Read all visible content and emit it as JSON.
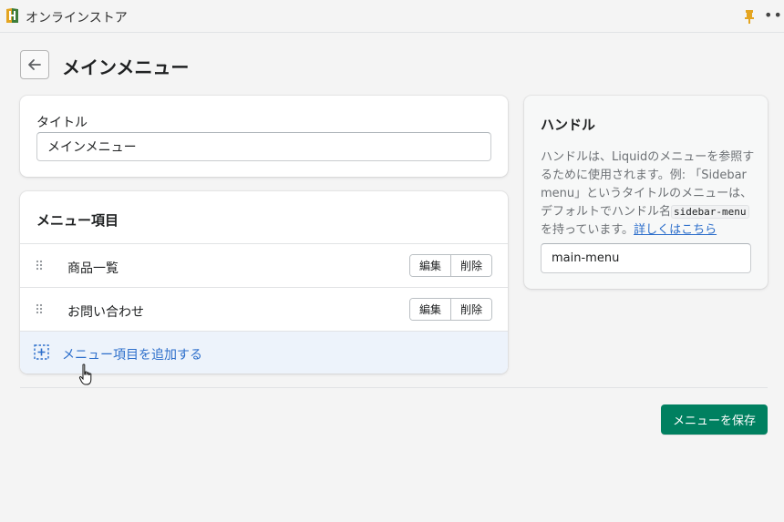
{
  "topbar": {
    "app_icon": "store-logo-icon",
    "app_title": "オンラインストア",
    "pin_icon": "pin-icon",
    "more_icon": "more-horizontal-icon",
    "more_glyph": "•••"
  },
  "header": {
    "back_icon": "arrow-left-icon",
    "title": "メインメニュー"
  },
  "title_card": {
    "label": "タイトル",
    "input_value": "メインメニュー"
  },
  "menu_card": {
    "heading": "メニュー項目",
    "items": [
      {
        "label": "商品一覧",
        "edit_label": "編集",
        "delete_label": "削除"
      },
      {
        "label": "お問い合わせ",
        "edit_label": "編集",
        "delete_label": "削除"
      }
    ],
    "add_label": "メニュー項目を追加する"
  },
  "handle_card": {
    "title": "ハンドル",
    "description_part1": "ハンドルは、Liquidのメニューを参照するために使用されます。例: 「Sidebar menu」というタイトルのメニューは、デフォルトでハンドル名",
    "description_code": "sidebar-menu",
    "description_part2": "を持っています。",
    "learn_more_link": "詳しくはこちら",
    "input_value": "main-menu"
  },
  "footer": {
    "save_label": "メニューを保存"
  },
  "colors": {
    "primary": "#008060",
    "link": "#2c6ecb",
    "highlight_row": "#edf3fb"
  }
}
